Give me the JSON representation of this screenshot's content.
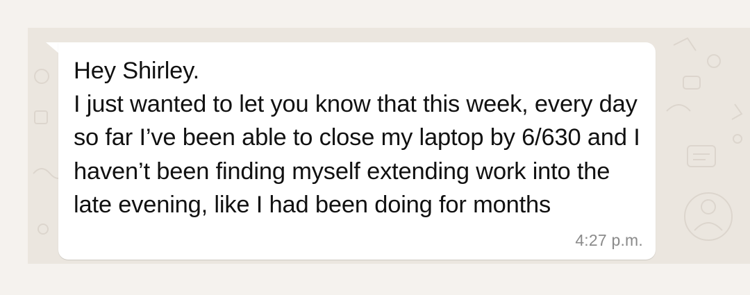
{
  "conversation": {
    "message": {
      "text": "Hey Shirley.\nI just wanted to let you know that this week, every day so far I’ve been able to close my laptop by 6/630 and I haven’t been finding myself extending work into the late evening, like I had been doing for months",
      "timestamp": "4:27 p.m."
    }
  },
  "colors": {
    "page_background": "#f5f2ee",
    "chat_background": "#ebe6df",
    "bubble_background": "#ffffff",
    "message_text": "#111111",
    "timestamp_text": "#8a8a8a"
  }
}
